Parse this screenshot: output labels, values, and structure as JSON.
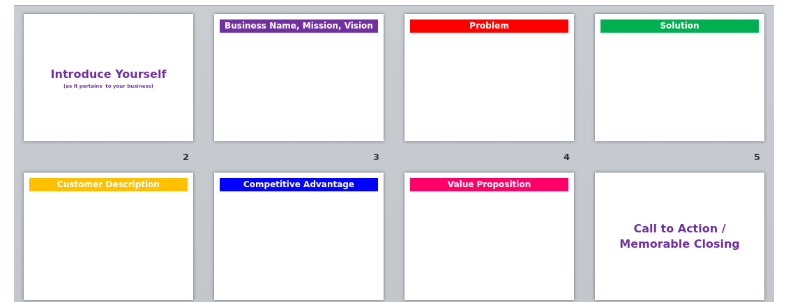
{
  "slides": [
    {
      "kind": "title",
      "title": "Introduce Yourself",
      "subtitle": "(as it pertains  to your business)",
      "number": "2"
    },
    {
      "kind": "banner",
      "title": "Business Name, Mission, Vision",
      "color": "#7030a0",
      "number": "3"
    },
    {
      "kind": "banner",
      "title": "Problem",
      "color": "#ff0000",
      "number": "4"
    },
    {
      "kind": "banner",
      "title": "Solution",
      "color": "#00b050",
      "number": "5"
    },
    {
      "kind": "banner",
      "title": "Customer Description",
      "color": "#ffc000"
    },
    {
      "kind": "banner",
      "title": "Competitive Advantage",
      "color": "#0000ff"
    },
    {
      "kind": "banner",
      "title": "Value Proposition",
      "color": "#ff0066"
    },
    {
      "kind": "title",
      "title": "Call to Action /\nMemorable Closing"
    }
  ]
}
